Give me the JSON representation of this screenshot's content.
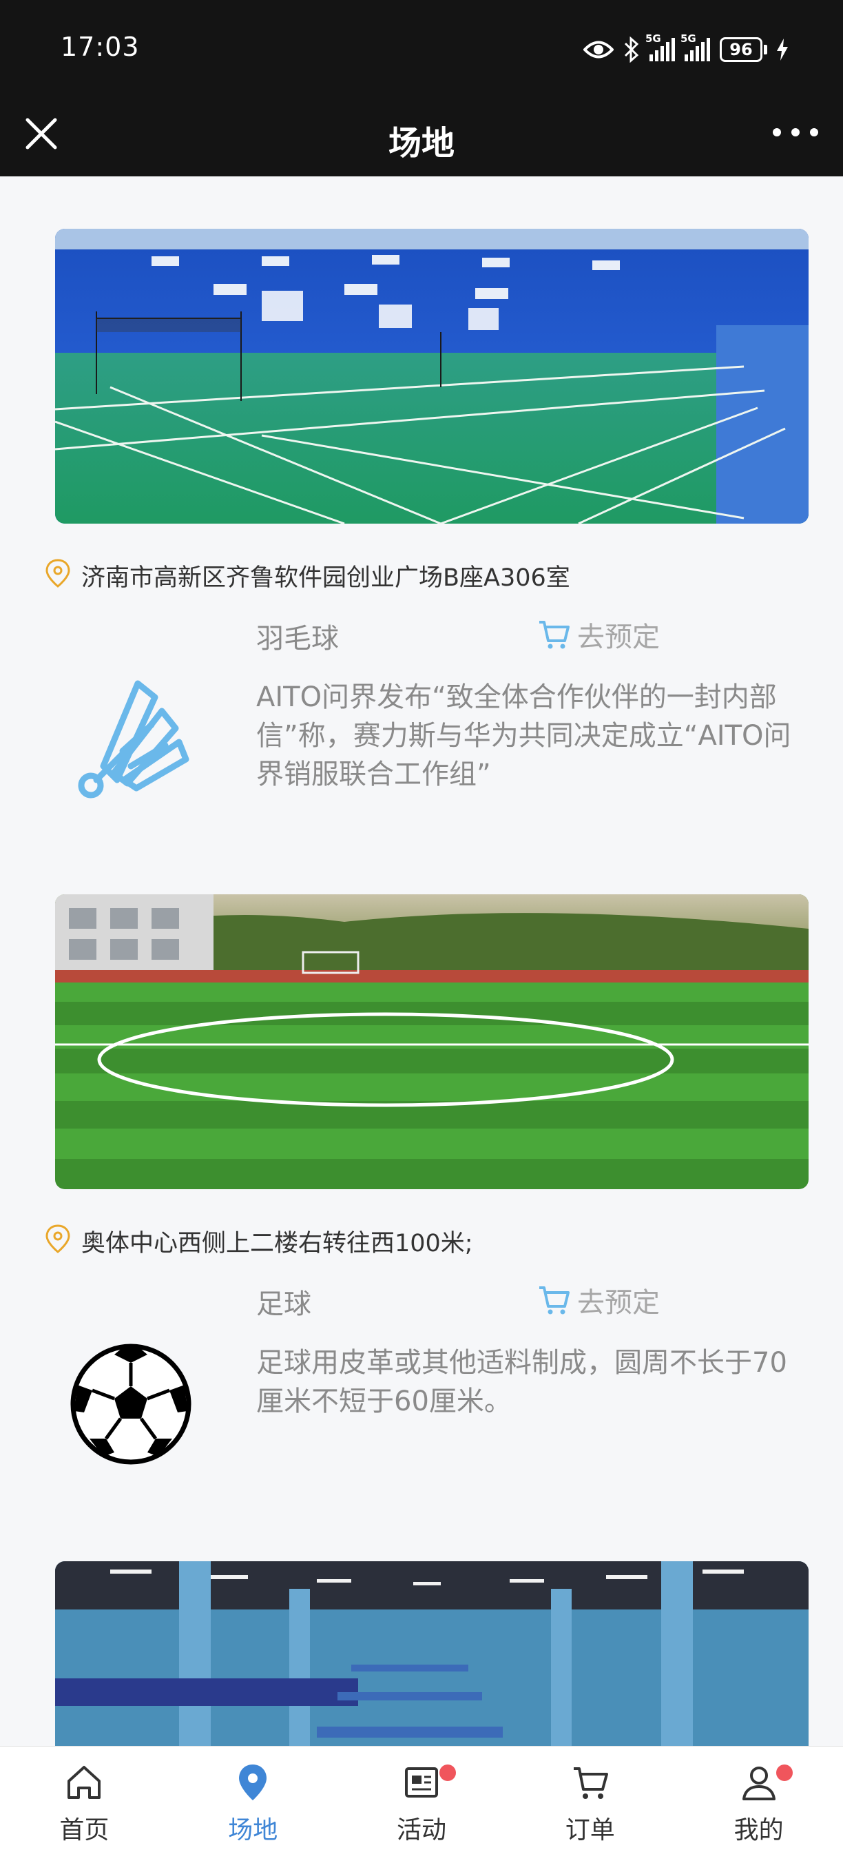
{
  "status_bar": {
    "time": "17:03",
    "signal_tag": "5G",
    "battery": "96"
  },
  "header": {
    "title": "场地"
  },
  "colors": {
    "accent": "#3f86d6",
    "pin": "#e9a72a",
    "badge": "#f0555c"
  },
  "venues": [
    {
      "address": "济南市高新区齐鲁软件园创业广场B座A306室",
      "sport": "羽毛球",
      "book_label": "去预定",
      "description": "AITO问界发布“致全体合作伙伴的一封内部信”称，赛力斯与华为共同决定成立“AITO问界销服联合工作组”",
      "icon": "badminton-shuttlecock-icon",
      "photo": "badminton-court-photo"
    },
    {
      "address": "奥体中心西侧上二楼右转往西100米;",
      "sport": "足球",
      "book_label": "去预定",
      "description": "足球用皮革或其他适料制成，圆周不长于70厘米不短于60厘米。",
      "icon": "soccer-ball-icon",
      "photo": "football-field-photo"
    },
    {
      "photo": "table-tennis-hall-photo"
    }
  ],
  "tabbar": {
    "items": [
      {
        "label": "首页",
        "icon": "home-icon"
      },
      {
        "label": "场地",
        "icon": "location-icon",
        "active": true
      },
      {
        "label": "活动",
        "icon": "news-icon",
        "badge": true
      },
      {
        "label": "订单",
        "icon": "cart-icon"
      },
      {
        "label": "我的",
        "icon": "user-icon",
        "badge": true
      }
    ]
  }
}
